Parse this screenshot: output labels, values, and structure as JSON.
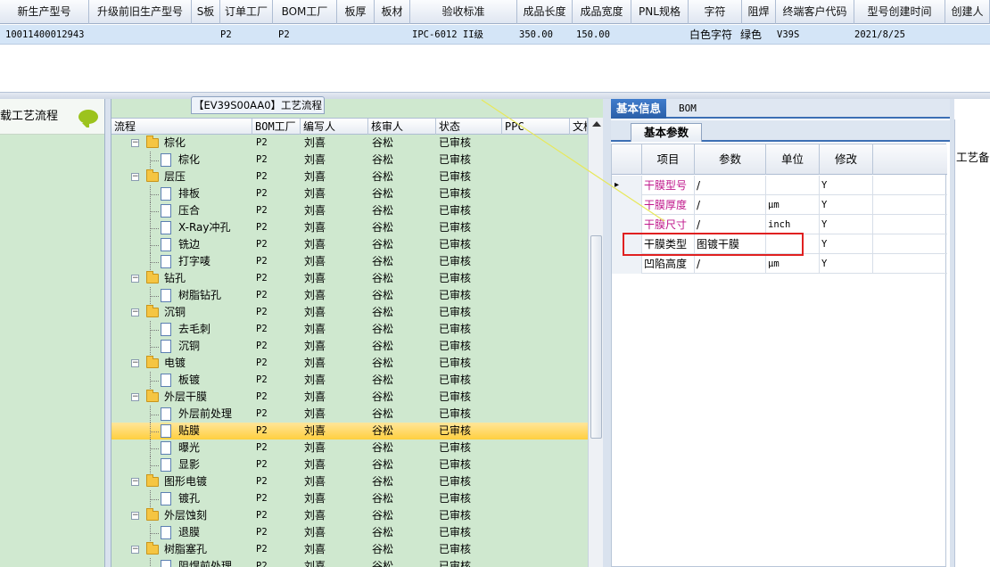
{
  "top_grid": {
    "columns": [
      "新生产型号",
      "升级前旧生产型号",
      "S板",
      "订单工厂",
      "BOM工厂",
      "板厚",
      "板材",
      "验收标准",
      "成品长度",
      "成品宽度",
      "PNL规格",
      "字符",
      "阻焊",
      "终端客户代码",
      "型号创建时间",
      "创建人"
    ],
    "row": {
      "new_model": "10011400012943",
      "s_board": "P2",
      "order_factory": "P2",
      "standard": "IPC-6012 II级",
      "length": "350.00",
      "width": "150.00",
      "legend": "白色字符",
      "solder_mask": "绿色",
      "customer_code": "V39S",
      "created": "2021/8/25"
    }
  },
  "left_panel": {
    "header": "载工艺流程"
  },
  "tree": {
    "title": "【EV39S00AA0】工艺流程",
    "columns": [
      "流程",
      "BOM工厂",
      "编写人",
      "核审人",
      "状态",
      "PPC",
      "文档"
    ],
    "rows": [
      {
        "name": "棕化",
        "level": 0,
        "factory": "P2",
        "writer": "刘喜",
        "reviewer": "谷松",
        "status": "已审核"
      },
      {
        "name": "棕化",
        "level": 1,
        "factory": "P2",
        "writer": "刘喜",
        "reviewer": "谷松",
        "status": "已审核"
      },
      {
        "name": "层压",
        "level": 0,
        "factory": "P2",
        "writer": "刘喜",
        "reviewer": "谷松",
        "status": "已审核"
      },
      {
        "name": "排板",
        "level": 1,
        "factory": "P2",
        "writer": "刘喜",
        "reviewer": "谷松",
        "status": "已审核"
      },
      {
        "name": "压合",
        "level": 1,
        "factory": "P2",
        "writer": "刘喜",
        "reviewer": "谷松",
        "status": "已审核"
      },
      {
        "name": "X-Ray冲孔",
        "level": 1,
        "factory": "P2",
        "writer": "刘喜",
        "reviewer": "谷松",
        "status": "已审核"
      },
      {
        "name": "铣边",
        "level": 1,
        "factory": "P2",
        "writer": "刘喜",
        "reviewer": "谷松",
        "status": "已审核"
      },
      {
        "name": "打字唛",
        "level": 1,
        "factory": "P2",
        "writer": "刘喜",
        "reviewer": "谷松",
        "status": "已审核"
      },
      {
        "name": "钻孔",
        "level": 0,
        "factory": "P2",
        "writer": "刘喜",
        "reviewer": "谷松",
        "status": "已审核"
      },
      {
        "name": "树脂钻孔",
        "level": 1,
        "factory": "P2",
        "writer": "刘喜",
        "reviewer": "谷松",
        "status": "已审核"
      },
      {
        "name": "沉铜",
        "level": 0,
        "factory": "P2",
        "writer": "刘喜",
        "reviewer": "谷松",
        "status": "已审核"
      },
      {
        "name": "去毛刺",
        "level": 1,
        "factory": "P2",
        "writer": "刘喜",
        "reviewer": "谷松",
        "status": "已审核"
      },
      {
        "name": "沉铜",
        "level": 1,
        "factory": "P2",
        "writer": "刘喜",
        "reviewer": "谷松",
        "status": "已审核"
      },
      {
        "name": "电镀",
        "level": 0,
        "factory": "P2",
        "writer": "刘喜",
        "reviewer": "谷松",
        "status": "已审核"
      },
      {
        "name": "板镀",
        "level": 1,
        "factory": "P2",
        "writer": "刘喜",
        "reviewer": "谷松",
        "status": "已审核"
      },
      {
        "name": "外层干膜",
        "level": 0,
        "factory": "P2",
        "writer": "刘喜",
        "reviewer": "谷松",
        "status": "已审核"
      },
      {
        "name": "外层前处理",
        "level": 1,
        "factory": "P2",
        "writer": "刘喜",
        "reviewer": "谷松",
        "status": "已审核"
      },
      {
        "name": "贴膜",
        "level": 1,
        "factory": "P2",
        "writer": "刘喜",
        "reviewer": "谷松",
        "status": "已审核",
        "selected": true
      },
      {
        "name": "曝光",
        "level": 1,
        "factory": "P2",
        "writer": "刘喜",
        "reviewer": "谷松",
        "status": "已审核"
      },
      {
        "name": "显影",
        "level": 1,
        "factory": "P2",
        "writer": "刘喜",
        "reviewer": "谷松",
        "status": "已审核"
      },
      {
        "name": "图形电镀",
        "level": 0,
        "factory": "P2",
        "writer": "刘喜",
        "reviewer": "谷松",
        "status": "已审核"
      },
      {
        "name": "镀孔",
        "level": 1,
        "factory": "P2",
        "writer": "刘喜",
        "reviewer": "谷松",
        "status": "已审核"
      },
      {
        "name": "外层蚀刻",
        "level": 0,
        "factory": "P2",
        "writer": "刘喜",
        "reviewer": "谷松",
        "status": "已审核"
      },
      {
        "name": "退膜",
        "level": 1,
        "factory": "P2",
        "writer": "刘喜",
        "reviewer": "谷松",
        "status": "已审核"
      },
      {
        "name": "树脂塞孔",
        "level": 0,
        "factory": "P2",
        "writer": "刘喜",
        "reviewer": "谷松",
        "status": "已审核"
      },
      {
        "name": "阻焊前处理",
        "level": 1,
        "factory": "P2",
        "writer": "刘喜",
        "reviewer": "谷松",
        "status": "已审核"
      }
    ]
  },
  "right_panel": {
    "tabs": [
      "基本信息",
      "BOM"
    ],
    "sub_tab": "基本参数",
    "grid_columns": [
      "项目",
      "参数",
      "单位",
      "修改"
    ],
    "params": [
      {
        "item": "干膜型号",
        "param": "/",
        "unit": "",
        "edit": "Y",
        "pink": true
      },
      {
        "item": "干膜厚度",
        "param": "/",
        "unit": "μm",
        "edit": "Y",
        "pink": true
      },
      {
        "item": "干膜尺寸",
        "param": "/",
        "unit": "inch",
        "edit": "Y",
        "pink": true
      },
      {
        "item": "干膜类型",
        "param": "图镀干膜",
        "unit": "",
        "edit": "Y",
        "pink": false
      },
      {
        "item": "凹陷高度",
        "param": "/",
        "unit": "μm",
        "edit": "Y",
        "pink": false
      }
    ]
  },
  "far_panel": {
    "label": "工艺备注"
  },
  "colors": {
    "tree_bg": "#cfe8cf",
    "selected_row": "#ffd24a",
    "accent": "#3c6fb4",
    "highlight_box": "#e02020",
    "pink_text": "#c0188c"
  }
}
